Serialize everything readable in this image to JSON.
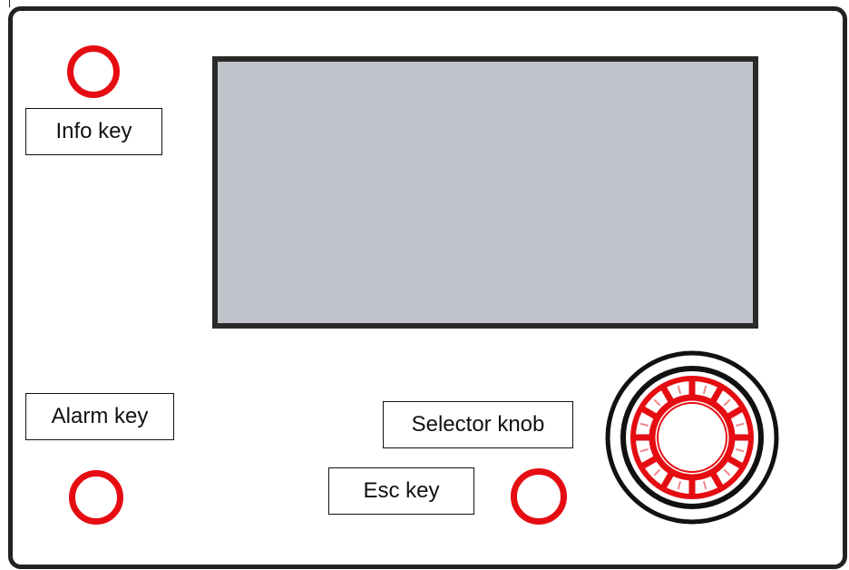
{
  "labels": {
    "info_key": "Info key",
    "alarm_key": "Alarm key",
    "selector_knob": "Selector knob",
    "esc_key": "Esc key"
  },
  "colors": {
    "key_red": "#e50d12",
    "display_gray": "#c0c3c9",
    "frame": "#222222"
  }
}
